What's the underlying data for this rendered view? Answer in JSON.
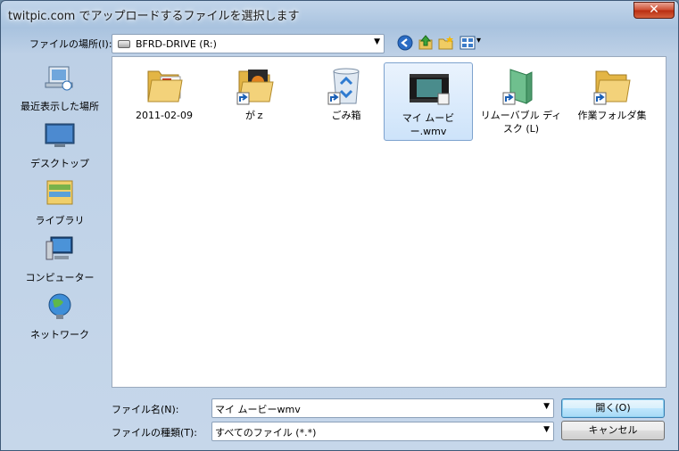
{
  "window": {
    "title": "twitpic.com でアップロードするファイルを選択します",
    "close_glyph": "✕"
  },
  "toolbar": {
    "look_in_label": "ファイルの場所(I):",
    "look_in_value": "BFRD-DRIVE (R:)",
    "arrow_glyph": "▼",
    "view_arrow": "▾"
  },
  "places": [
    {
      "label": "最近表示した場所",
      "icon": "recent-places-icon"
    },
    {
      "label": "デスクトップ",
      "icon": "desktop-icon"
    },
    {
      "label": "ライブラリ",
      "icon": "libraries-icon"
    },
    {
      "label": "コンピューター",
      "icon": "computer-icon"
    },
    {
      "label": "ネットワーク",
      "icon": "network-icon"
    }
  ],
  "files": [
    {
      "label": "2011-02-09",
      "icon": "folder-icon"
    },
    {
      "label": "がｚ",
      "icon": "folder-shortcut-icon"
    },
    {
      "label": "ごみ箱",
      "icon": "recycle-bin-icon"
    },
    {
      "label": "マイ ムービー.wmv",
      "icon": "video-file-icon"
    },
    {
      "label": "リムーバブル ディスク (L)",
      "icon": "removable-disk-icon"
    },
    {
      "label": "作業フォルダ集",
      "icon": "folder-shortcut-icon"
    }
  ],
  "bottom": {
    "filename_label": "ファイル名(N):",
    "filename_value": "マイ ムービーwmv",
    "filetype_label": "ファイルの種類(T):",
    "filetype_value": "すべてのファイル (*.*)",
    "open_button": "開く(O)",
    "cancel_button": "キャンセル"
  },
  "colors": {
    "accent": "#3c7fb1",
    "close": "#cd4b2f"
  }
}
